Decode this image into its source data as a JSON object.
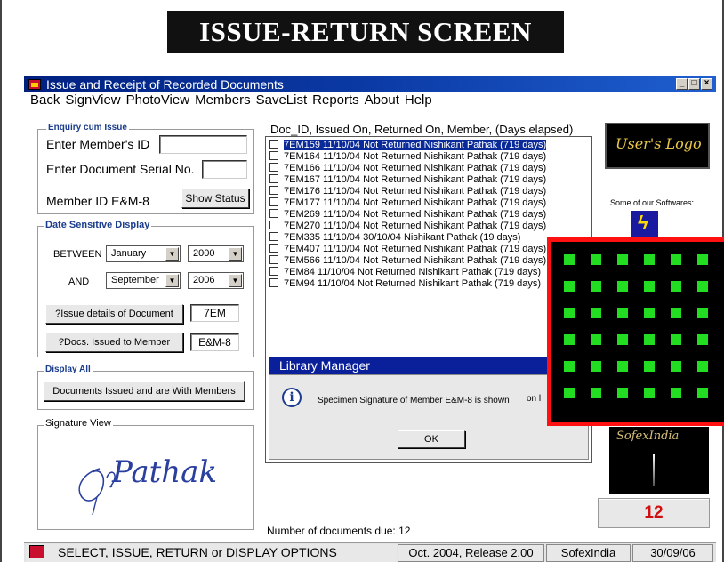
{
  "banner": "ISSUE-RETURN SCREEN",
  "window": {
    "title": "Issue and Receipt of Recorded Documents"
  },
  "menu": [
    "Back",
    "SignView",
    "PhotoView",
    "Members",
    "SaveList",
    "Reports",
    "About",
    "Help"
  ],
  "enquiry": {
    "label": "Enquiry cum  Issue",
    "member_id_label": "Enter Member's ID",
    "member_id_value": "",
    "doc_serial_label": "Enter Document Serial No.",
    "doc_serial_value": "",
    "member_id_display": "Member ID E&M-8",
    "show_status": "Show Status"
  },
  "date_display": {
    "label": "Date Sensitive Display",
    "between_label": "BETWEEN",
    "and_label": "AND",
    "from_month": "January",
    "from_year": "2000",
    "to_month": "September",
    "to_year": "2006",
    "issue_details_button": "?Issue details of Document",
    "issue_details_value": "7EM",
    "docs_issued_button": "?Docs. Issued to Member",
    "docs_issued_value": "E&M-8"
  },
  "display_all": {
    "label": "Display All",
    "button": "Documents Issued and are With Members"
  },
  "signature": {
    "label": "Signature View",
    "text": "Pathak"
  },
  "list": {
    "header": "Doc_ID, Issued On, Returned On, Member, (Days elapsed)",
    "rows": [
      "7EM159  11/10/04  Not Returned  Nishikant Pathak (719 days)",
      "7EM164  11/10/04  Not Returned  Nishikant Pathak (719 days)",
      "7EM166  11/10/04  Not Returned  Nishikant Pathak (719 days)",
      "7EM167  11/10/04  Not Returned  Nishikant Pathak (719 days)",
      "7EM176  11/10/04  Not Returned  Nishikant Pathak (719 days)",
      "7EM177  11/10/04  Not Returned  Nishikant Pathak (719 days)",
      "7EM269  11/10/04  Not Returned  Nishikant Pathak (719 days)",
      "7EM270  11/10/04  Not Returned  Nishikant Pathak (719 days)",
      "7EM335  11/10/04  30/10/04  Nishikant Pathak (19 days)",
      "7EM407  11/10/04  Not Returned  Nishikant Pathak (719 days)",
      "7EM566  11/10/04  Not Returned  Nishikant Pathak (719 days)",
      "7EM84  11/10/04  Not Returned  Nishikant Pathak (719 days)",
      "7EM94  11/10/04  Not Returned  Nishikant Pathak (719 days)"
    ],
    "due_label": "Number of documents due: 12"
  },
  "dialog": {
    "title": "Library Manager",
    "message": "Specimen Signature of Member E&M-8 is shown",
    "message_tail": "on l",
    "ok": "OK"
  },
  "side": {
    "logo_text": "User's Logo",
    "some_softwares": "Some of our Softwares:",
    "sofex_logo": "SofexIndia",
    "count": "12"
  },
  "statusbar": {
    "message": "SELECT, ISSUE, RETURN or DISPLAY OPTIONS",
    "release": "Oct. 2004, Release 2.00",
    "company": "SofexIndia",
    "date": "30/09/06"
  },
  "colors": {
    "accent": "#1b3d8c",
    "overlay_border": "#ff1111",
    "overlay_cell": "#22dd22",
    "count": "#d01010"
  }
}
